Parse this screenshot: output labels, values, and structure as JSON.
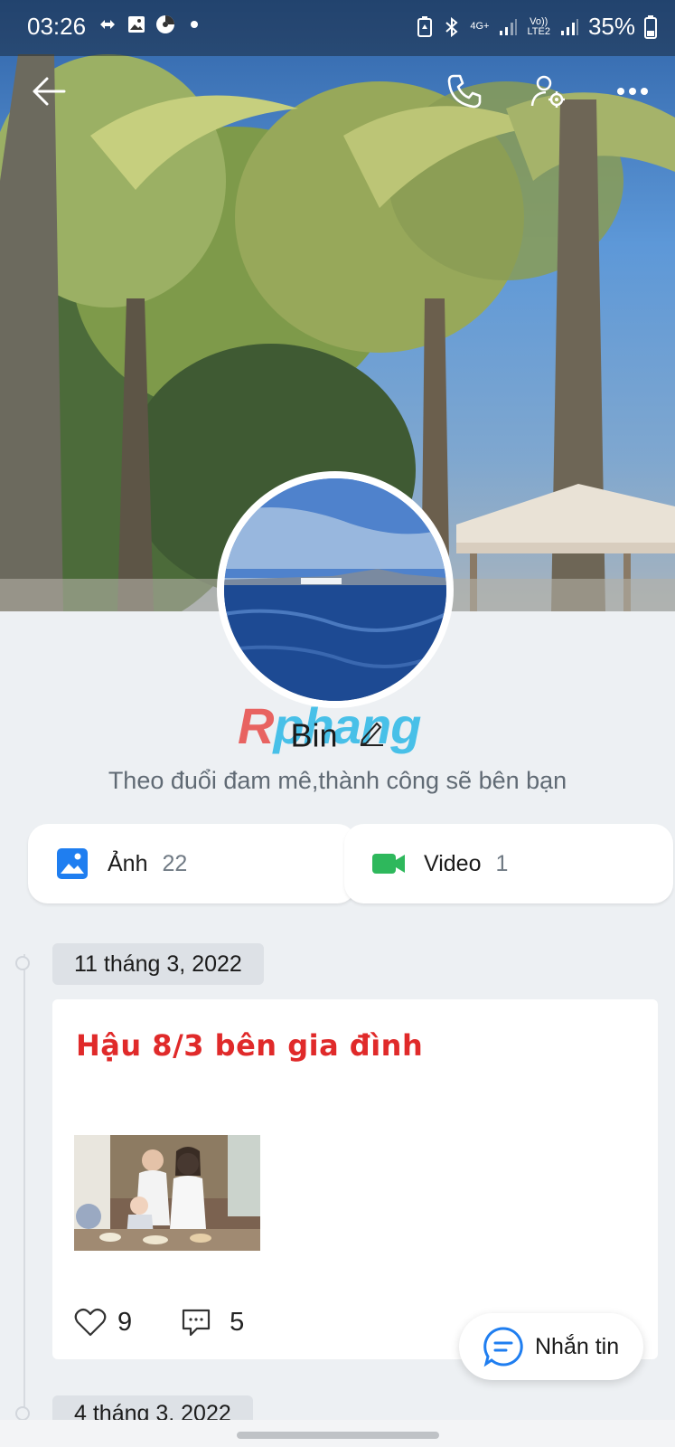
{
  "status_bar": {
    "time": "03:26",
    "network_4g": "4G+",
    "network_lte": "Vo))\nLTE2",
    "battery": "35%"
  },
  "profile": {
    "name": "Bin",
    "bio": "Theo đuổi đam mê,thành công sẽ bên bạn",
    "watermark": "Rphang",
    "watermark_first": "R",
    "watermark_rest": "phang"
  },
  "media": {
    "photos_label": "Ảnh",
    "photos_count": "22",
    "videos_label": "Video",
    "videos_count": "1"
  },
  "feed": {
    "date_1": "11 tháng 3, 2022",
    "post_1": {
      "title": "Hậu 8/3 bên gia đình",
      "likes": "9",
      "comments": "5"
    },
    "date_2": "4 tháng 3, 2022"
  },
  "fab": {
    "label": "Nhắn tin"
  },
  "colors": {
    "accent_blue": "#1f7ef0",
    "video_green": "#2eb85c",
    "post_title_red": "#e02a2a"
  }
}
